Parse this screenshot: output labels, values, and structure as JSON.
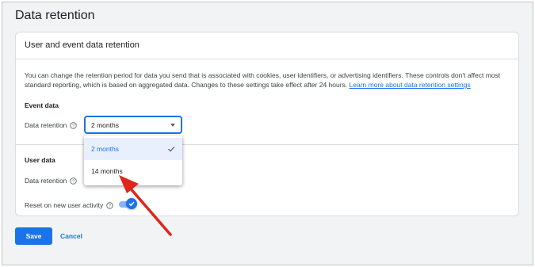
{
  "page": {
    "title": "Data retention"
  },
  "card": {
    "title": "User and event data retention",
    "description": "You can change the retention period for data you send that is associated with cookies, user identifiers, or advertising identifiers. These controls don't affect most standard reporting, which is based on aggregated data. Changes to these settings take effect after 24 hours.",
    "learn_more": "Learn more about data retention settings"
  },
  "event_data": {
    "heading": "Event data",
    "retention_label": "Data retention",
    "selected_value": "2 months",
    "options": [
      "2 months",
      "14 months"
    ]
  },
  "user_data": {
    "heading": "User data",
    "retention_label": "Data retention",
    "reset_label": "Reset on new user activity",
    "reset_enabled": true
  },
  "actions": {
    "save": "Save",
    "cancel": "Cancel"
  },
  "colors": {
    "accent": "#1a73e8",
    "annotation_arrow": "#e0251b"
  },
  "icons": {
    "help": "help-circle-icon",
    "check": "check-icon",
    "caret": "caret-down-icon"
  }
}
